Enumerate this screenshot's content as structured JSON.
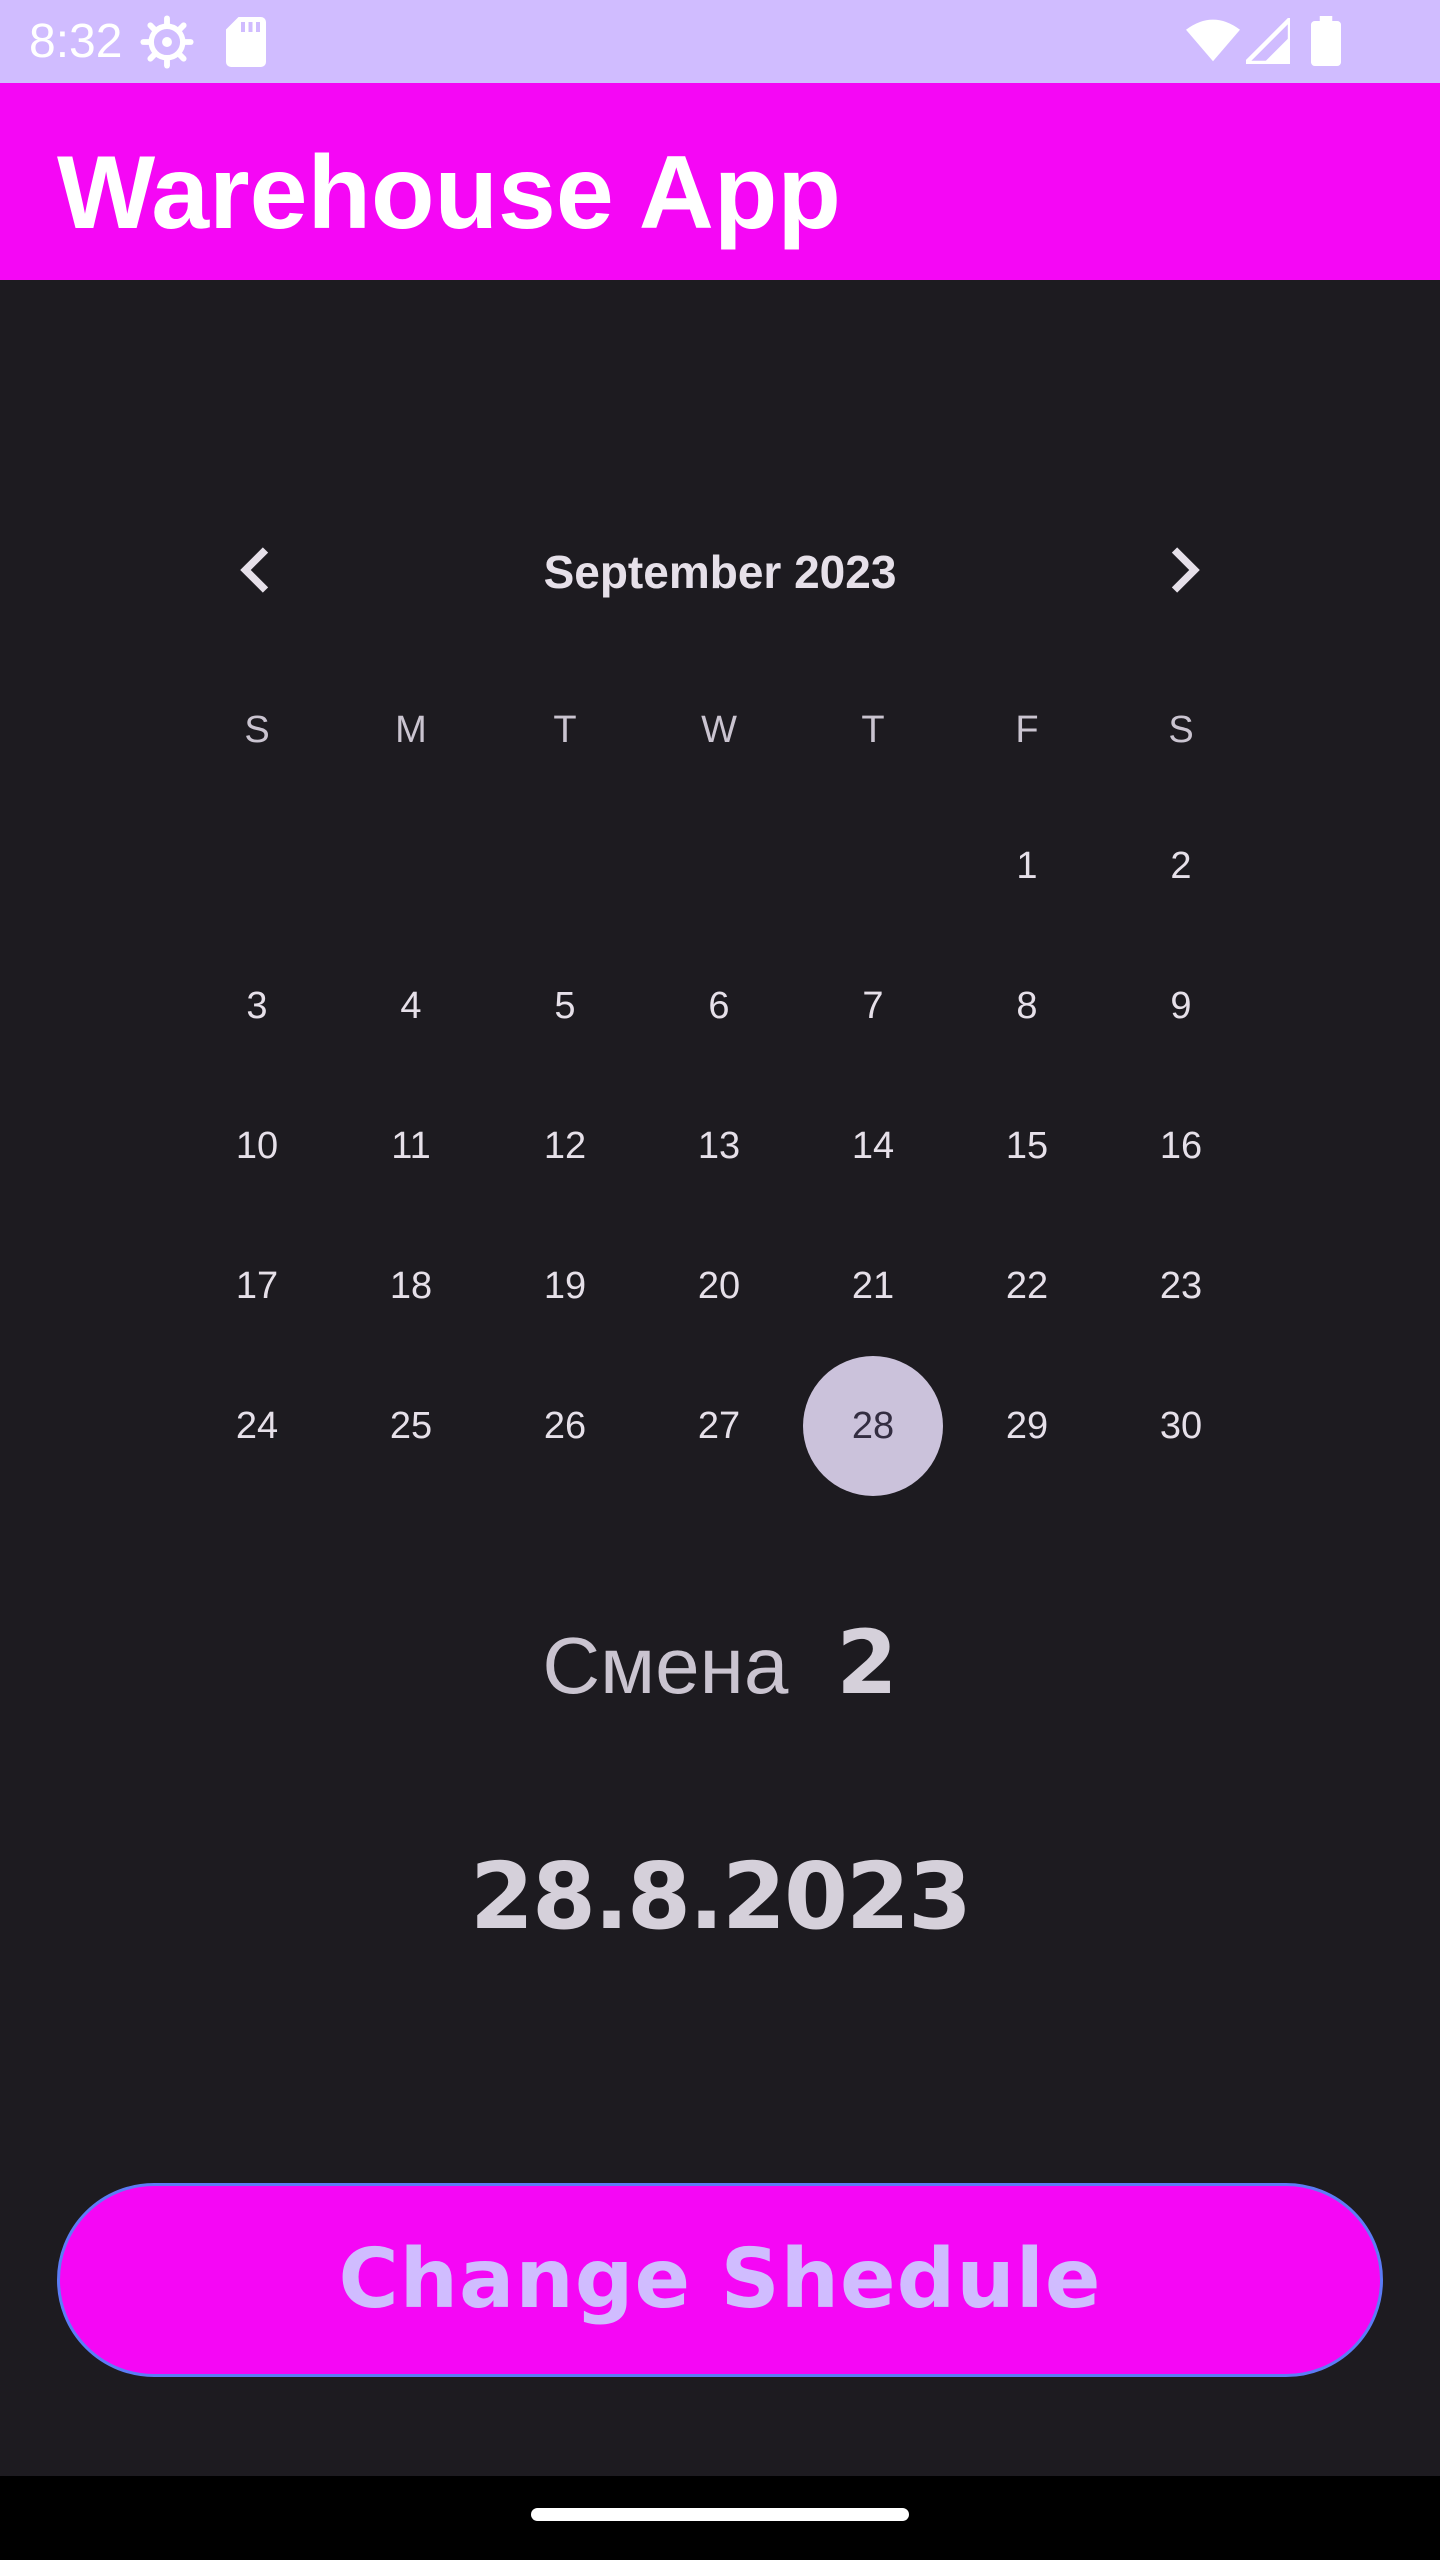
{
  "status_bar": {
    "time": "8:32",
    "icons": [
      "gear-icon",
      "sd-card-icon",
      "wifi-icon",
      "signal-icon",
      "battery-icon"
    ]
  },
  "app_bar": {
    "title": "Warehouse App"
  },
  "calendar": {
    "month_label": "September 2023",
    "weekdays": [
      "S",
      "M",
      "T",
      "W",
      "T",
      "F",
      "S"
    ],
    "days": [
      "1",
      "2",
      "3",
      "4",
      "5",
      "6",
      "7",
      "8",
      "9",
      "10",
      "11",
      "12",
      "13",
      "14",
      "15",
      "16",
      "17",
      "18",
      "19",
      "20",
      "21",
      "22",
      "23",
      "24",
      "25",
      "26",
      "27",
      "28",
      "29",
      "30"
    ],
    "selected_day": "28"
  },
  "shift": {
    "label": "Смена",
    "number": "2"
  },
  "selected_date": "28.8.2023",
  "button": {
    "label": "Change Shedule"
  },
  "colors": {
    "status_bar": "#d0bcff",
    "app_bar": "#f507f5",
    "background": "#1d1b20",
    "selected_day_bg": "#cbc2db",
    "button_bg": "#f507f5",
    "button_text": "#d0bcff",
    "button_border": "#5c7cf6"
  }
}
